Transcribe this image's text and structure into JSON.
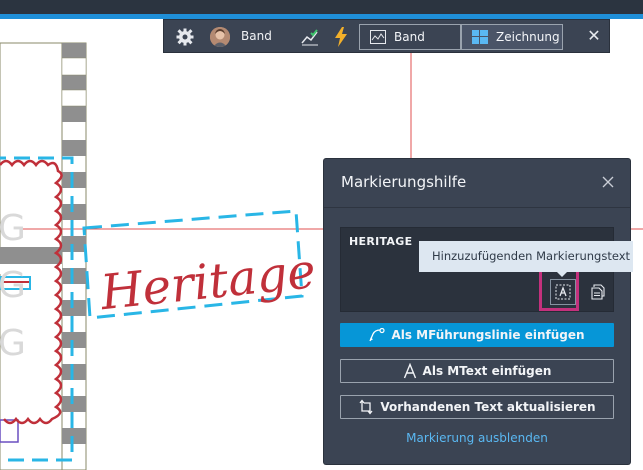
{
  "toolbar": {
    "user_name": "Band",
    "band_label": "Band",
    "drawing_label": "Zeichnung"
  },
  "panel": {
    "title": "Markierungshilfe",
    "recognized_text": "HERITAGE",
    "tooltip": "Hinzuzufügenden Markierungstext",
    "buttons": {
      "leader": "Als MFührungslinie einfügen",
      "mtext": "Als MText einfügen",
      "update": "Vorhandenen Text aktualisieren"
    },
    "hide_link": "Markierung ausblenden"
  },
  "drawing": {
    "handwriting": "Heritage",
    "faded_letters": [
      "G",
      "G",
      "G"
    ]
  },
  "colors": {
    "accent": "#1f8fd8",
    "panel_bg": "#3b4453",
    "primary_button": "#0696d7",
    "highlight": "#c4317d",
    "markup_cyan": "#29b6e6",
    "markup_red": "#c0303a"
  }
}
